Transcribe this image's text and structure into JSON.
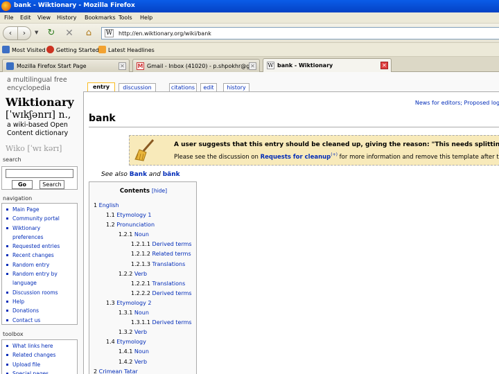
{
  "window": {
    "title": "bank - Wiktionary - Mozilla Firefox"
  },
  "menubar": [
    "File",
    "Edit",
    "View",
    "History",
    "Bookmarks",
    "Tools",
    "Help"
  ],
  "navbar": {
    "url": "http://en.wiktionary.org/wiki/bank"
  },
  "bookmarks": [
    "Most Visited",
    "Getting Started",
    "Latest Headlines"
  ],
  "tabs": [
    {
      "label": "Mozilla Firefox Start Page",
      "active": false
    },
    {
      "label": "Gmail - Inbox (41020) - p.shpokhr@g",
      "active": false
    },
    {
      "label": "bank - Wiktionary",
      "active": true
    }
  ],
  "logo": {
    "tagline1": "a multilingual free",
    "tagline2": "encyclopedia",
    "name": "Wiktionary",
    "ipa": "[ˈwɪkʃənrɪ] n.,",
    "description": "a wiki-based Open Content dictionary",
    "ipa2": "Wiko [ˈwɪ kərɪ]"
  },
  "search": {
    "title": "search",
    "go_label": "Go",
    "search_label": "Search"
  },
  "navigation": {
    "title": "navigation",
    "items": [
      [
        "Main Page"
      ],
      [
        "Community portal"
      ],
      [
        "Wiktionary",
        "preferences"
      ],
      [
        "Requested entries"
      ],
      [
        "Recent changes"
      ],
      [
        "Random entry"
      ],
      [
        "Random entry by",
        "language"
      ],
      [
        "Discussion rooms"
      ],
      [
        "Help"
      ],
      [
        "Donations"
      ],
      [
        "Contact us"
      ]
    ]
  },
  "toolbox": {
    "title": "toolbox",
    "items": [
      "What links here",
      "Related changes",
      "Upload file",
      "Special pages"
    ]
  },
  "content_tabs": [
    "entry",
    "discussion",
    "citations",
    "edit",
    "history"
  ],
  "site_notice": "News for editors; Proposed logo",
  "heading": "bank",
  "cleanup": {
    "line1": "A user suggests that this entry should be cleaned up, giving the reason: \"This needs splitting into m",
    "line2_pre": "Please see the discussion on ",
    "line2_link": "Requests for cleanup",
    "line2_sup": "(+)",
    "line2_post": " for more information and remove this template after th"
  },
  "see_also": {
    "prefix": "See also ",
    "link1": "Bank",
    "conj": " and ",
    "link2": "bänk"
  },
  "toc": {
    "title": "Contents",
    "hide": "[hide]",
    "items": [
      {
        "num": "1",
        "text": "English",
        "level": 0
      },
      {
        "num": "1.1",
        "text": "Etymology 1",
        "level": 1
      },
      {
        "num": "1.2",
        "text": "Pronunciation",
        "level": 1
      },
      {
        "num": "1.2.1",
        "text": "Noun",
        "level": 2
      },
      {
        "num": "1.2.1.1",
        "text": "Derived terms",
        "level": 3
      },
      {
        "num": "1.2.1.2",
        "text": "Related terms",
        "level": 3
      },
      {
        "num": "1.2.1.3",
        "text": "Translations",
        "level": 3
      },
      {
        "num": "1.2.2",
        "text": "Verb",
        "level": 2
      },
      {
        "num": "1.2.2.1",
        "text": "Translations",
        "level": 3
      },
      {
        "num": "1.2.2.2",
        "text": "Derived terms",
        "level": 3
      },
      {
        "num": "1.3",
        "text": "Etymology 2",
        "level": 1
      },
      {
        "num": "1.3.1",
        "text": "Noun",
        "level": 2
      },
      {
        "num": "1.3.1.1",
        "text": "Derived terms",
        "level": 3
      },
      {
        "num": "1.3.2",
        "text": "Verb",
        "level": 2
      },
      {
        "num": "1.4",
        "text": "Etymology",
        "level": 1
      },
      {
        "num": "1.4.1",
        "text": "Noun",
        "level": 2
      },
      {
        "num": "1.4.2",
        "text": "Verb",
        "level": 2
      },
      {
        "num": "2",
        "text": "Crimean Tatar",
        "level": 0
      }
    ]
  },
  "colors": {
    "link": "#002bb8",
    "titlebar": "#0a5ce8",
    "cleanup_bg": "#f8eaba"
  }
}
